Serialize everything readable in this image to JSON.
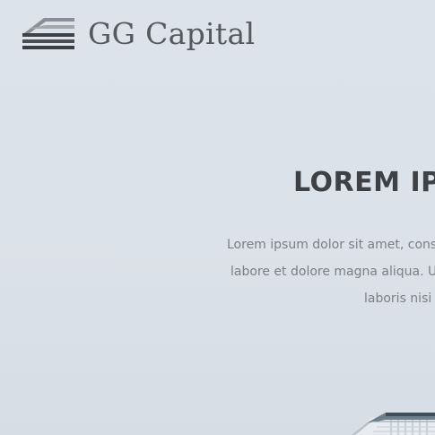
{
  "header": {
    "brand_name": "GG Capital",
    "logo_icon": "building-stack-logo"
  },
  "hero": {
    "title": "LOREM IPS",
    "lines": [
      "Lorem ipsum dolor sit amet, cons",
      "labore et dolore magna aliqua. U",
      "laboris nisi"
    ]
  },
  "colors": {
    "background": "#dde3ea",
    "brand_text": "#555a60",
    "title_text": "#3d4045",
    "body_text": "#7b7f84"
  }
}
